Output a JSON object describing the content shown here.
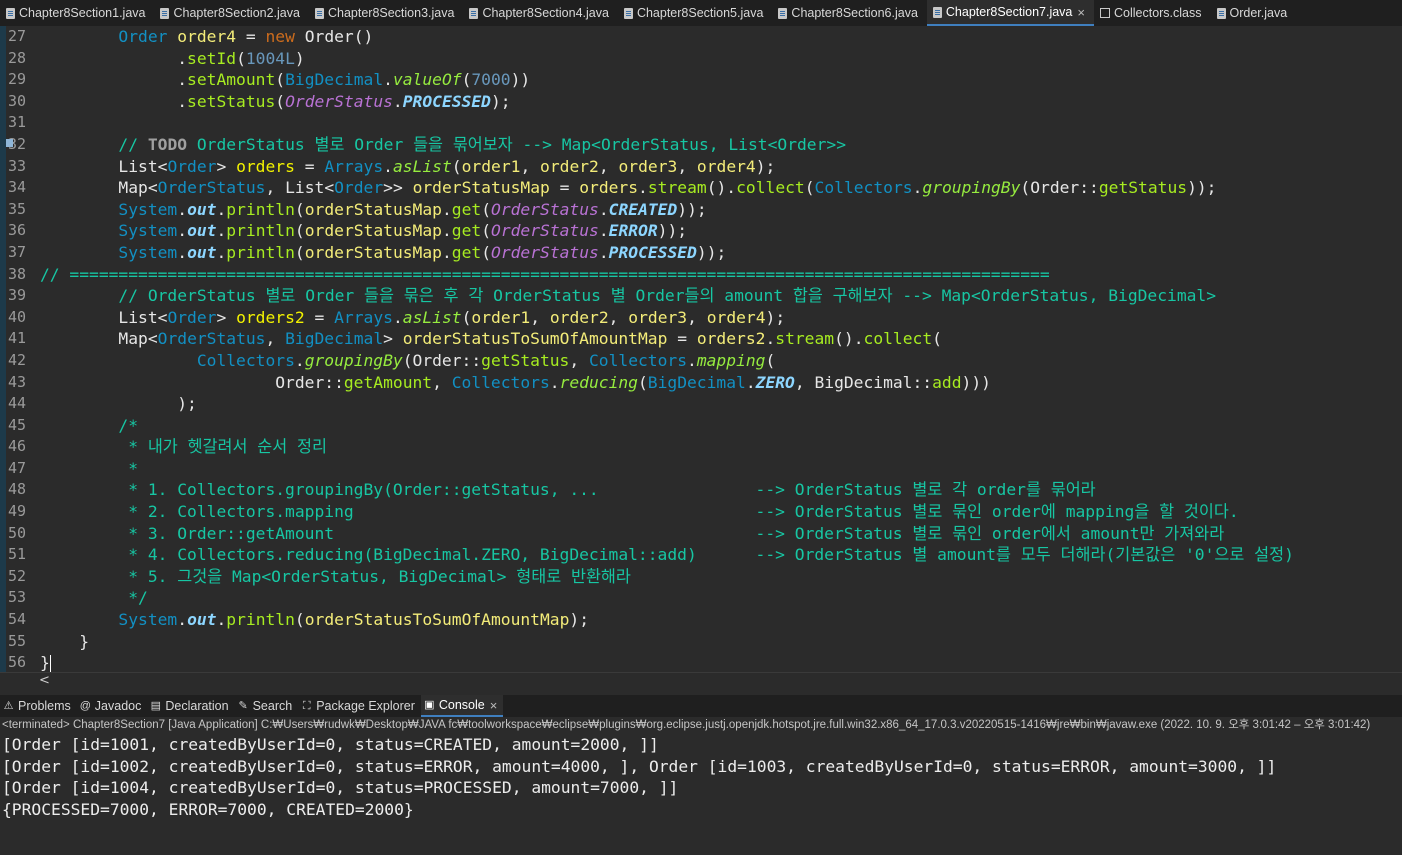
{
  "editor_tabs": [
    {
      "label": "Chapter8Section1.java",
      "icon": "java-file-icon",
      "active": false
    },
    {
      "label": "Chapter8Section2.java",
      "icon": "java-file-icon",
      "active": false
    },
    {
      "label": "Chapter8Section3.java",
      "icon": "java-file-icon",
      "active": false
    },
    {
      "label": "Chapter8Section4.java",
      "icon": "java-file-icon",
      "active": false
    },
    {
      "label": "Chapter8Section5.java",
      "icon": "java-file-icon",
      "active": false
    },
    {
      "label": "Chapter8Section6.java",
      "icon": "java-file-icon",
      "active": false
    },
    {
      "label": "Chapter8Section7.java",
      "icon": "java-file-icon",
      "active": true,
      "close": "×"
    },
    {
      "label": "Collectors.class",
      "icon": "class-file-icon",
      "active": false
    },
    {
      "label": "Order.java",
      "icon": "java-file-icon",
      "active": false
    }
  ],
  "editor": {
    "line_numbers": [
      "27",
      "28",
      "29",
      "30",
      "31",
      "32",
      "33",
      "34",
      "35",
      "36",
      "37",
      "38",
      "39",
      "40",
      "41",
      "42",
      "43",
      "44",
      "45",
      "46",
      "47",
      "48",
      "49",
      "50",
      "51",
      "52",
      "53",
      "54",
      "55",
      "56"
    ],
    "lines": [
      [
        [
          "        ",
          "plain"
        ],
        [
          "Order",
          "type"
        ],
        [
          " ",
          "plain"
        ],
        [
          "order4",
          "var"
        ],
        [
          " = ",
          "plain"
        ],
        [
          "new",
          "kw"
        ],
        [
          " Order()",
          "plain"
        ]
      ],
      [
        [
          "              .",
          "plain"
        ],
        [
          "setId",
          "method"
        ],
        [
          "(",
          "plain"
        ],
        [
          "1004L",
          "num"
        ],
        [
          ")",
          "plain"
        ]
      ],
      [
        [
          "              .",
          "plain"
        ],
        [
          "setAmount",
          "method"
        ],
        [
          "(",
          "plain"
        ],
        [
          "BigDecimal",
          "type"
        ],
        [
          ".",
          "plain"
        ],
        [
          "valueOf",
          "static"
        ],
        [
          "(",
          "plain"
        ],
        [
          "7000",
          "num"
        ],
        [
          "))",
          "plain"
        ]
      ],
      [
        [
          "              .",
          "plain"
        ],
        [
          "setStatus",
          "method"
        ],
        [
          "(",
          "plain"
        ],
        [
          "OrderStatus",
          "enum"
        ],
        [
          ".",
          "plain"
        ],
        [
          "PROCESSED",
          "const"
        ],
        [
          ");",
          "plain"
        ]
      ],
      [
        [
          "",
          "plain"
        ]
      ],
      [
        [
          "        ",
          "plain"
        ],
        [
          "// ",
          "comment"
        ],
        [
          "TODO",
          "todo"
        ],
        [
          " OrderStatus 별로 Order 들을 묶어보자 --> Map<OrderStatus, List<Order>>",
          "comment"
        ]
      ],
      [
        [
          "        ",
          "plain"
        ],
        [
          "List",
          "plain"
        ],
        [
          "<",
          "plain"
        ],
        [
          "Order",
          "type"
        ],
        [
          "> ",
          "plain"
        ],
        [
          "orders",
          "varl"
        ],
        [
          " = ",
          "plain"
        ],
        [
          "Arrays",
          "type"
        ],
        [
          ".",
          "plain"
        ],
        [
          "asList",
          "static"
        ],
        [
          "(",
          "plain"
        ],
        [
          "order1",
          "var"
        ],
        [
          ", ",
          "plain"
        ],
        [
          "order2",
          "var"
        ],
        [
          ", ",
          "plain"
        ],
        [
          "order3",
          "var"
        ],
        [
          ", ",
          "plain"
        ],
        [
          "order4",
          "var"
        ],
        [
          ");",
          "plain"
        ]
      ],
      [
        [
          "        ",
          "plain"
        ],
        [
          "Map",
          "plain"
        ],
        [
          "<",
          "plain"
        ],
        [
          "OrderStatus",
          "type"
        ],
        [
          ", ",
          "plain"
        ],
        [
          "List",
          "plain"
        ],
        [
          "<",
          "plain"
        ],
        [
          "Order",
          "type"
        ],
        [
          ">> ",
          "plain"
        ],
        [
          "orderStatusMap",
          "var"
        ],
        [
          " = ",
          "plain"
        ],
        [
          "orders",
          "var"
        ],
        [
          ".",
          "plain"
        ],
        [
          "stream",
          "method"
        ],
        [
          "().",
          "plain"
        ],
        [
          "collect",
          "method"
        ],
        [
          "(",
          "plain"
        ],
        [
          "Collectors",
          "type"
        ],
        [
          ".",
          "plain"
        ],
        [
          "groupingBy",
          "static"
        ],
        [
          "(Order::",
          "plain"
        ],
        [
          "getStatus",
          "method"
        ],
        [
          "));",
          "plain"
        ]
      ],
      [
        [
          "        ",
          "plain"
        ],
        [
          "System",
          "type"
        ],
        [
          ".",
          "plain"
        ],
        [
          "out",
          "field"
        ],
        [
          ".",
          "plain"
        ],
        [
          "println",
          "method"
        ],
        [
          "(",
          "plain"
        ],
        [
          "orderStatusMap",
          "var"
        ],
        [
          ".",
          "plain"
        ],
        [
          "get",
          "method"
        ],
        [
          "(",
          "plain"
        ],
        [
          "OrderStatus",
          "enum"
        ],
        [
          ".",
          "plain"
        ],
        [
          "CREATED",
          "const"
        ],
        [
          "));",
          "plain"
        ]
      ],
      [
        [
          "        ",
          "plain"
        ],
        [
          "System",
          "type"
        ],
        [
          ".",
          "plain"
        ],
        [
          "out",
          "field"
        ],
        [
          ".",
          "plain"
        ],
        [
          "println",
          "method"
        ],
        [
          "(",
          "plain"
        ],
        [
          "orderStatusMap",
          "var"
        ],
        [
          ".",
          "plain"
        ],
        [
          "get",
          "method"
        ],
        [
          "(",
          "plain"
        ],
        [
          "OrderStatus",
          "enum"
        ],
        [
          ".",
          "plain"
        ],
        [
          "ERROR",
          "const"
        ],
        [
          "));",
          "plain"
        ]
      ],
      [
        [
          "        ",
          "plain"
        ],
        [
          "System",
          "type"
        ],
        [
          ".",
          "plain"
        ],
        [
          "out",
          "field"
        ],
        [
          ".",
          "plain"
        ],
        [
          "println",
          "method"
        ],
        [
          "(",
          "plain"
        ],
        [
          "orderStatusMap",
          "var"
        ],
        [
          ".",
          "plain"
        ],
        [
          "get",
          "method"
        ],
        [
          "(",
          "plain"
        ],
        [
          "OrderStatus",
          "enum"
        ],
        [
          ".",
          "plain"
        ],
        [
          "PROCESSED",
          "const"
        ],
        [
          "));",
          "plain"
        ]
      ],
      [
        [
          "// ====================================================================================================",
          "comment"
        ]
      ],
      [
        [
          "        // OrderStatus 별로 Order 들을 묶은 후 각 OrderStatus 별 Order들의 amount 합을 구해보자 --> Map<OrderStatus, BigDecimal>",
          "comment"
        ]
      ],
      [
        [
          "        ",
          "plain"
        ],
        [
          "List",
          "plain"
        ],
        [
          "<",
          "plain"
        ],
        [
          "Order",
          "type"
        ],
        [
          "> ",
          "plain"
        ],
        [
          "orders2",
          "varl"
        ],
        [
          " = ",
          "plain"
        ],
        [
          "Arrays",
          "type"
        ],
        [
          ".",
          "plain"
        ],
        [
          "asList",
          "static"
        ],
        [
          "(",
          "plain"
        ],
        [
          "order1",
          "var"
        ],
        [
          ", ",
          "plain"
        ],
        [
          "order2",
          "var"
        ],
        [
          ", ",
          "plain"
        ],
        [
          "order3",
          "var"
        ],
        [
          ", ",
          "plain"
        ],
        [
          "order4",
          "var"
        ],
        [
          ");",
          "plain"
        ]
      ],
      [
        [
          "        ",
          "plain"
        ],
        [
          "Map",
          "plain"
        ],
        [
          "<",
          "plain"
        ],
        [
          "OrderStatus",
          "type"
        ],
        [
          ", ",
          "plain"
        ],
        [
          "BigDecimal",
          "type"
        ],
        [
          "> ",
          "plain"
        ],
        [
          "orderStatusToSumOfAmountMap",
          "var"
        ],
        [
          " = ",
          "plain"
        ],
        [
          "orders2",
          "var"
        ],
        [
          ".",
          "plain"
        ],
        [
          "stream",
          "method"
        ],
        [
          "().",
          "plain"
        ],
        [
          "collect",
          "method"
        ],
        [
          "(",
          "plain"
        ]
      ],
      [
        [
          "                ",
          "plain"
        ],
        [
          "Collectors",
          "type"
        ],
        [
          ".",
          "plain"
        ],
        [
          "groupingBy",
          "static"
        ],
        [
          "(Order::",
          "plain"
        ],
        [
          "getStatus",
          "method"
        ],
        [
          ", ",
          "plain"
        ],
        [
          "Collectors",
          "type"
        ],
        [
          ".",
          "plain"
        ],
        [
          "mapping",
          "static"
        ],
        [
          "(",
          "plain"
        ]
      ],
      [
        [
          "                        Order::",
          "plain"
        ],
        [
          "getAmount",
          "method"
        ],
        [
          ", ",
          "plain"
        ],
        [
          "Collectors",
          "type"
        ],
        [
          ".",
          "plain"
        ],
        [
          "reducing",
          "static"
        ],
        [
          "(",
          "plain"
        ],
        [
          "BigDecimal",
          "type"
        ],
        [
          ".",
          "plain"
        ],
        [
          "ZERO",
          "const"
        ],
        [
          ", BigDecimal::",
          "plain"
        ],
        [
          "add",
          "method"
        ],
        [
          ")))",
          "plain"
        ]
      ],
      [
        [
          "              );",
          "plain"
        ]
      ],
      [
        [
          "        /*",
          "comment"
        ]
      ],
      [
        [
          "         * 내가 헷갈려서 순서 정리",
          "comment"
        ]
      ],
      [
        [
          "         *",
          "comment"
        ]
      ],
      [
        [
          "         * 1. Collectors.groupingBy(Order::getStatus, ...                --> OrderStatus 별로 각 order를 묶어라",
          "comment"
        ]
      ],
      [
        [
          "         * 2. Collectors.mapping                                         --> OrderStatus 별로 묶인 order에 mapping을 할 것이다.",
          "comment"
        ]
      ],
      [
        [
          "         * 3. Order::getAmount                                           --> OrderStatus 별로 묶인 order에서 amount만 가져와라",
          "comment"
        ]
      ],
      [
        [
          "         * 4. Collectors.reducing(BigDecimal.ZERO, BigDecimal::add)      --> OrderStatus 별 amount를 모두 더해라(기본값은 '0'으로 설정)",
          "comment"
        ]
      ],
      [
        [
          "         * 5. 그것을 Map<OrderStatus, BigDecimal> 형태로 반환해라",
          "comment"
        ]
      ],
      [
        [
          "         */",
          "comment"
        ]
      ],
      [
        [
          "        ",
          "plain"
        ],
        [
          "System",
          "type"
        ],
        [
          ".",
          "plain"
        ],
        [
          "out",
          "field"
        ],
        [
          ".",
          "plain"
        ],
        [
          "println",
          "method"
        ],
        [
          "(",
          "plain"
        ],
        [
          "orderStatusToSumOfAmountMap",
          "var"
        ],
        [
          ");",
          "plain"
        ]
      ],
      [
        [
          "    }",
          "plain"
        ]
      ],
      [
        [
          "}",
          "plain"
        ]
      ]
    ]
  },
  "view_tabs": [
    {
      "label": "Problems",
      "icon": "problems-icon",
      "glyph": "⚠",
      "active": false
    },
    {
      "label": "Javadoc",
      "icon": "javadoc-icon",
      "glyph": "@",
      "active": false
    },
    {
      "label": "Declaration",
      "icon": "declaration-icon",
      "glyph": "▤",
      "active": false
    },
    {
      "label": "Search",
      "icon": "search-icon",
      "glyph": "✎",
      "active": false
    },
    {
      "label": "Package Explorer",
      "icon": "package-explorer-icon",
      "glyph": "⛶",
      "active": false
    },
    {
      "label": "Console",
      "icon": "console-icon",
      "glyph": "▣",
      "active": true,
      "close": "×"
    }
  ],
  "console": {
    "header": "<terminated> Chapter8Section7 [Java Application] C:₩Users₩rudwk₩Desktop₩JAVA fc₩toolworkspace₩eclipse₩plugins₩org.eclipse.justj.openjdk.hotspot.jre.full.win32.x86_64_17.0.3.v20220515-1416₩jre₩bin₩javaw.exe  (2022. 10. 9. 오후 3:01:42 – 오후 3:01:42)",
    "output": [
      "[Order [id=1001, createdByUserId=0, status=CREATED, amount=2000, ]]",
      "[Order [id=1002, createdByUserId=0, status=ERROR, amount=4000, ], Order [id=1003, createdByUserId=0, status=ERROR, amount=3000, ]]",
      "[Order [id=1004, createdByUserId=0, status=PROCESSED, amount=7000, ]]",
      "{PROCESSED=7000, ERROR=7000, CREATED=2000}"
    ]
  },
  "scroll": {
    "left_arrow": "<"
  }
}
